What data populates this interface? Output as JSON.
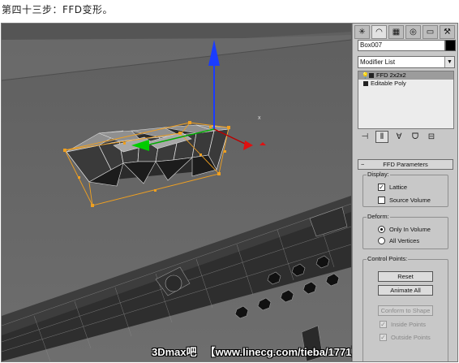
{
  "caption": "第四十三步：FFD变形。",
  "watermark": {
    "brand": "3Dmax吧",
    "url": "【www.linecg.com/tieba/1771】"
  },
  "panel": {
    "tabs": [
      "create-icon",
      "modify-icon",
      "hierarchy-icon",
      "motion-icon",
      "display-icon",
      "utilities-icon"
    ],
    "object_name": "Box007",
    "modifier_list_label": "Modifier List",
    "stack": [
      {
        "label": "FFD 2x2x2",
        "selected": true
      },
      {
        "label": "Editable Poly",
        "selected": false
      }
    ],
    "rollout_title": "FFD Parameters",
    "display": {
      "title": "Display:",
      "lattice": "Lattice",
      "source_volume": "Source Volume"
    },
    "deform": {
      "title": "Deform:",
      "only_in_volume": "Only In Volume",
      "all_vertices": "All Vertices"
    },
    "control_points": {
      "title": "Control Points:",
      "reset": "Reset",
      "animate_all": "Animate All",
      "conform": "Conform to Shape",
      "inside_points": "Inside Points",
      "outside_points": "Outside Points"
    }
  }
}
